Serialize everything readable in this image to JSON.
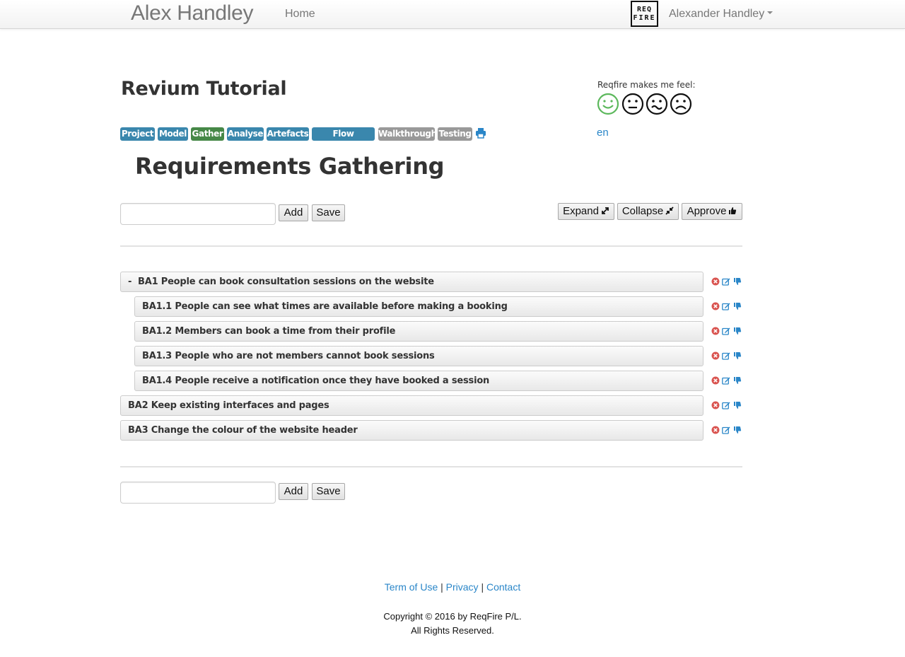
{
  "navbar": {
    "brand": "Alex Handley",
    "home": "Home",
    "logo_line1": "REQ",
    "logo_line2": "FIRE",
    "user": "Alexander Handley"
  },
  "project": {
    "title": "Revium Tutorial",
    "feel_label": "Reqfire makes me feel:",
    "faces": [
      "happy-face-icon",
      "neutral-face-icon",
      "confused-face-icon",
      "sad-face-icon"
    ],
    "language": "en"
  },
  "tabs": [
    {
      "label": "Project",
      "color": "#3a87ad"
    },
    {
      "label": "Model",
      "color": "#3a87ad"
    },
    {
      "label": "Gather",
      "color": "#468847"
    },
    {
      "label": "Analyse",
      "color": "#3a87ad"
    },
    {
      "label": "Artefacts",
      "color": "#3a87ad"
    },
    {
      "label": "Flow Designer",
      "color": "#3a87ad"
    },
    {
      "label": "Walkthrough",
      "color": "#999999"
    },
    {
      "label": "Testing",
      "color": "#999999"
    }
  ],
  "section_title": "Requirements Gathering",
  "toolbar": {
    "input_value": "",
    "add_label": "Add",
    "save_label": "Save",
    "expand_label": "Expand",
    "collapse_label": "Collapse",
    "approve_label": "Approve"
  },
  "requirements": [
    {
      "toggle": "-",
      "text": "BA1 People can book consultation sessions on the website",
      "level": 0
    },
    {
      "toggle": "",
      "text": "BA1.1 People can see what times are available before making a booking",
      "level": 1
    },
    {
      "toggle": "",
      "text": "BA1.2 Members can book a time from their profile",
      "level": 1
    },
    {
      "toggle": "",
      "text": "BA1.3 People who are not members cannot book sessions",
      "level": 1
    },
    {
      "toggle": "",
      "text": "BA1.4 People receive a notification once they have booked a session",
      "level": 1
    },
    {
      "toggle": "",
      "text": "BA2 Keep existing interfaces and pages",
      "level": 0
    },
    {
      "toggle": "",
      "text": "BA3 Change the colour of the website header",
      "level": 0
    }
  ],
  "footer": {
    "terms": "Term of Use",
    "privacy": "Privacy",
    "contact": "Contact",
    "separator": "|",
    "copyright": "Copyright © 2016 by ReqFire P/L.",
    "rights": "All Rights Reserved."
  },
  "colors": {
    "link": "#2a86c8",
    "delete": "#d9534f",
    "happy": "#5cb85c"
  }
}
